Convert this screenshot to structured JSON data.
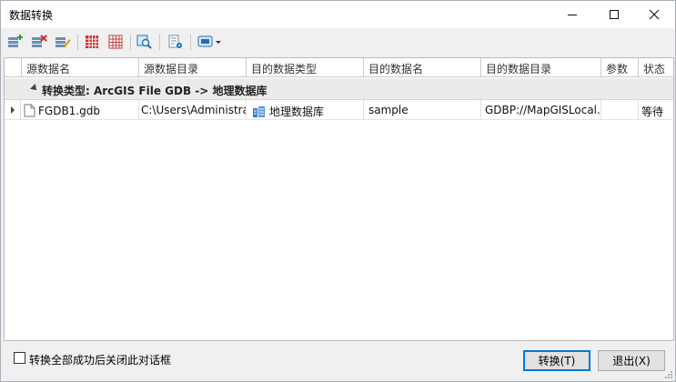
{
  "window": {
    "title": "数据转换",
    "accent_color": "#0078d7"
  },
  "titlebar_buttons": [
    {
      "name": "minimize-icon"
    },
    {
      "name": "maximize-icon"
    },
    {
      "name": "close-icon"
    }
  ],
  "toolbar": {
    "items": [
      {
        "icon": "add-data-icon",
        "color": "#2e9e3a"
      },
      {
        "icon": "remove-data-icon",
        "color": "#d42a2a"
      },
      {
        "icon": "edit-data-icon",
        "color": "#d4a017"
      },
      {
        "icon": "select-all-grid-icon",
        "color": "#d42a2a"
      },
      {
        "icon": "clear-grid-icon",
        "color": "#c04040"
      },
      {
        "icon": "preview-magnify-icon",
        "color": "#1f6fbf"
      },
      {
        "icon": "settings-doc-icon",
        "color": "#1f6fbf"
      },
      {
        "icon": "output-dropdown-icon",
        "color": "#1f6fbf"
      }
    ]
  },
  "grid": {
    "columns": [
      "源数据名",
      "源数据目录",
      "目的数据类型",
      "目的数据名",
      "目的数据目录",
      "参数",
      "状态"
    ],
    "group": {
      "label": "转换类型: ArcGIS File GDB -> 地理数据库"
    },
    "rows": [
      {
        "source_name": "FGDB1.gdb",
        "source_dir": "C:\\Users\\Administrator",
        "dest_type": "地理数据库",
        "dest_name": "sample",
        "dest_dir": "GDBP://MapGISLocal...",
        "params": "",
        "status": "等待"
      }
    ]
  },
  "footer": {
    "close_on_success_label": "转换全部成功后关闭此对话框",
    "close_on_success_checked": false,
    "convert_button": "转换(T)",
    "exit_button": "退出(X)"
  }
}
